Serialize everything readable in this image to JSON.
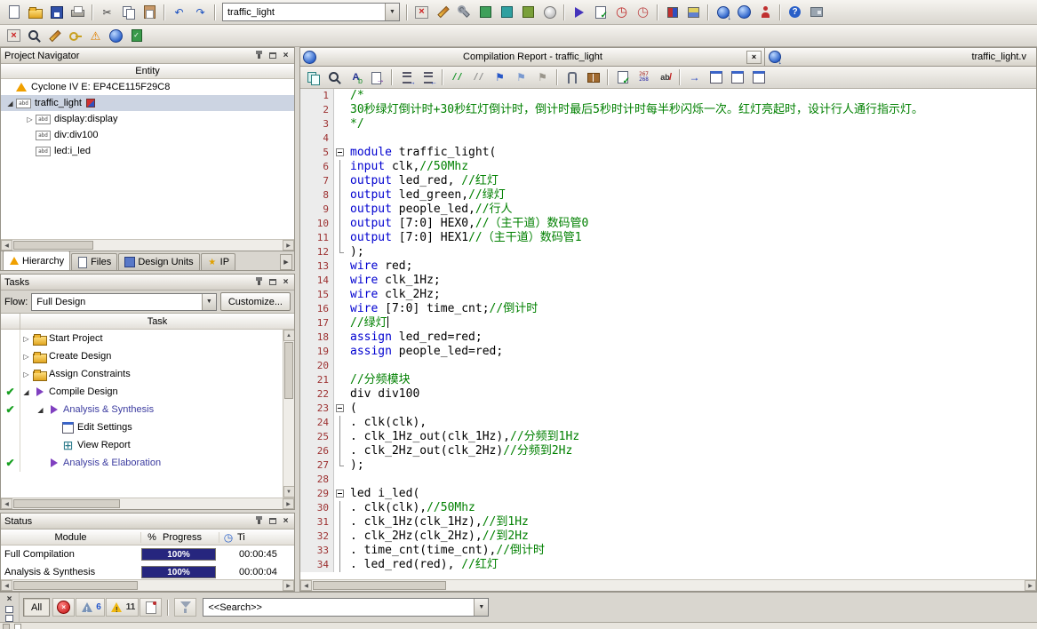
{
  "toolbar_main": {
    "combo_value": "traffic_light",
    "items_left": [
      {
        "n": "new-file",
        "s": "s-doc"
      },
      {
        "n": "open-file",
        "s": "s-folder"
      },
      {
        "n": "save",
        "s": "s-floppy"
      },
      {
        "n": "print",
        "s": "s-printer"
      },
      {
        "sep": 1
      },
      {
        "n": "cut",
        "g": "✂",
        "c": "#3a3a3a"
      },
      {
        "n": "copy",
        "s": "s-copy"
      },
      {
        "n": "paste",
        "s": "s-paste"
      },
      {
        "sep": 1
      },
      {
        "n": "undo",
        "g": "↶",
        "c": "#1a50c0"
      },
      {
        "n": "redo",
        "g": "↷",
        "c": "#1a50c0"
      },
      {
        "sep": 1
      }
    ],
    "items_right": [
      {
        "sep": 1
      },
      {
        "n": "stop-processing",
        "s": "s-redx"
      },
      {
        "n": "assignment-editor",
        "s": "s-pencil"
      },
      {
        "n": "pin-planner",
        "s": "s-wrench"
      },
      {
        "n": "rtl-viewer",
        "s": "s-chip"
      },
      {
        "n": "state-machine-viewer",
        "s": "s-chip2"
      },
      {
        "n": "technology-map-viewer",
        "s": "s-chip3"
      },
      {
        "n": "simulator",
        "s": "s-cd"
      },
      {
        "sep": 1
      },
      {
        "n": "start-compilation",
        "s": "s-play"
      },
      {
        "n": "start-analysis-synthesis",
        "s": "s-checkdoc"
      },
      {
        "n": "timequest-analyzer",
        "s": "s-clockred"
      },
      {
        "n": "timing-analyzer",
        "s": "s-clockred2"
      },
      {
        "sep": 1
      },
      {
        "n": "chip-planner",
        "s": "s-chipsm"
      },
      {
        "n": "design-partition",
        "s": "s-part"
      },
      {
        "sep": 1
      },
      {
        "n": "programmer",
        "s": "s-globedown"
      },
      {
        "n": "system-console",
        "s": "s-globe"
      },
      {
        "n": "qsys",
        "s": "s-person"
      },
      {
        "sep": 1
      },
      {
        "n": "help",
        "s": "s-help"
      },
      {
        "n": "system-builder",
        "s": "s-board"
      }
    ]
  },
  "toolbar_secondary": {
    "items": [
      {
        "n": "stop",
        "s": "s-redx"
      },
      {
        "n": "find",
        "s": "s-find"
      },
      {
        "n": "edit-pencil",
        "s": "s-pencil"
      },
      {
        "n": "key",
        "s": "s-key"
      },
      {
        "n": "alert",
        "s": "s-warno"
      },
      {
        "n": "web",
        "s": "s-globe"
      },
      {
        "n": "check-report",
        "s": "s-greendoc"
      }
    ]
  },
  "project_navigator": {
    "title": "Project Navigator",
    "entity_header": "Entity",
    "rows": [
      {
        "label": "Cyclone IV E: EP4CE115F29C8",
        "level": 0,
        "icon": "dev"
      },
      {
        "label": "traffic_light",
        "level": 0,
        "exp": "open",
        "icon": "abd",
        "badge": true,
        "selected": true
      },
      {
        "label": "display:display",
        "level": 1,
        "exp": "closed",
        "icon": "abd"
      },
      {
        "label": "div:div100",
        "level": 1,
        "icon": "abd"
      },
      {
        "label": "led:i_led",
        "level": 1,
        "icon": "abd"
      }
    ],
    "tabs": [
      {
        "label": "Hierarchy",
        "icon": "hier",
        "active": true
      },
      {
        "label": "Files",
        "icon": "files"
      },
      {
        "label": "Design Units",
        "icon": "du"
      },
      {
        "label": "IP",
        "icon": "ip"
      }
    ]
  },
  "tasks": {
    "title": "Tasks",
    "flow_label": "Flow:",
    "flow_value": "Full Design",
    "customize_label": "Customize...",
    "column_header": "Task",
    "rows": [
      {
        "label": "Start Project",
        "level": 1,
        "exp": "closed",
        "icon": "folder"
      },
      {
        "label": "Create Design",
        "level": 1,
        "exp": "closed",
        "icon": "folder"
      },
      {
        "label": "Assign Constraints",
        "level": 1,
        "exp": "closed",
        "icon": "folder"
      },
      {
        "label": "Compile Design",
        "level": 1,
        "exp": "open",
        "icon": "playp",
        "check": true
      },
      {
        "label": "Analysis & Synthesis",
        "level": 2,
        "exp": "open",
        "icon": "playp",
        "check": true,
        "emph": true
      },
      {
        "label": "Edit Settings",
        "level": 3,
        "icon": "winset"
      },
      {
        "label": "View Report",
        "level": 3,
        "icon": "grid"
      },
      {
        "label": "Analysis & Elaboration",
        "level": 2,
        "icon": "playp",
        "check": true,
        "emph": true
      }
    ]
  },
  "status": {
    "title": "Status",
    "columns": {
      "module": "Module",
      "percent": "%",
      "progress": "Progress",
      "time": "Ti"
    },
    "rows": [
      {
        "module": "Full Compilation",
        "progress": "100%",
        "time": "00:00:45"
      },
      {
        "module": "Analysis & Synthesis",
        "progress": "100%",
        "time": "00:00:04"
      }
    ]
  },
  "mdi": {
    "report_title": "Compilation Report - traffic_light",
    "editor_title": "traffic_light.v",
    "editor_toolbar": [
      {
        "n": "copy-document",
        "s": "s-copy2"
      },
      {
        "n": "find",
        "s": "s-find"
      },
      {
        "n": "find-replace",
        "s": "s-ab2"
      },
      {
        "n": "goto-line",
        "s": "s-goto"
      },
      {
        "sep": 1
      },
      {
        "n": "indent",
        "s": "s-ind"
      },
      {
        "n": "unindent",
        "s": "s-unind"
      },
      {
        "sep": 1
      },
      {
        "n": "comment",
        "s": "s-cmt"
      },
      {
        "n": "uncomment",
        "s": "s-uncmt"
      },
      {
        "n": "toggle-bookmark",
        "g": "⚑",
        "c": "#2858c8"
      },
      {
        "n": "next-bookmark",
        "g": "⚑",
        "c": "#7a9ad0"
      },
      {
        "n": "clear-bookmarks",
        "g": "⚑",
        "c": "#9a968c"
      },
      {
        "sep": 1
      },
      {
        "n": "insert-template",
        "s": "s-clip"
      },
      {
        "n": "templates-book",
        "s": "s-book"
      },
      {
        "sep": 1
      },
      {
        "n": "check-syntax",
        "s": "s-checkdoc"
      },
      {
        "n": "line-numbers",
        "s": "s-nums",
        "t1": "267",
        "t2": "268"
      },
      {
        "n": "word-wrap",
        "s": "s-abred"
      },
      {
        "sep": 1
      },
      {
        "n": "goto-matching",
        "g": "→",
        "c": "#2040c0"
      },
      {
        "n": "split-window-1",
        "s": "s-win"
      },
      {
        "n": "split-window-2",
        "s": "s-win"
      },
      {
        "n": "split-window-3",
        "s": "s-win"
      }
    ]
  },
  "editor": {
    "lines": [
      {
        "n": 1,
        "s": [
          [
            "c",
            "/*"
          ]
        ]
      },
      {
        "n": 2,
        "s": [
          [
            "c",
            "30秒绿灯倒计时+30秒红灯倒计时，倒计时最后5秒时计时每半秒闪烁一次。红灯亮起时，设计行人通行指示灯。"
          ]
        ]
      },
      {
        "n": 3,
        "s": [
          [
            "c",
            "*/"
          ]
        ]
      },
      {
        "n": 4,
        "s": []
      },
      {
        "n": 5,
        "f": "open",
        "s": [
          [
            "k",
            "module"
          ],
          [
            "p",
            " traffic_light("
          ]
        ]
      },
      {
        "n": 6,
        "f": "line",
        "s": [
          [
            "k",
            "input"
          ],
          [
            "p",
            " clk,"
          ],
          [
            "c",
            "//50Mhz"
          ]
        ]
      },
      {
        "n": 7,
        "f": "line",
        "s": [
          [
            "k",
            "output"
          ],
          [
            "p",
            " led_red, "
          ],
          [
            "c",
            "//红灯"
          ]
        ]
      },
      {
        "n": 8,
        "f": "line",
        "s": [
          [
            "k",
            "output"
          ],
          [
            "p",
            " led_green,"
          ],
          [
            "c",
            "//绿灯"
          ]
        ]
      },
      {
        "n": 9,
        "f": "line",
        "s": [
          [
            "k",
            "output"
          ],
          [
            "p",
            " people_led,"
          ],
          [
            "c",
            "//行人"
          ]
        ]
      },
      {
        "n": 10,
        "f": "line",
        "s": [
          [
            "k",
            "output"
          ],
          [
            "p",
            " [7:0] HEX0,"
          ],
          [
            "c",
            "//（主干道）数码管0"
          ]
        ]
      },
      {
        "n": 11,
        "f": "line",
        "s": [
          [
            "k",
            "output"
          ],
          [
            "p",
            " [7:0] HEX1"
          ],
          [
            "c",
            "//（主干道）数码管1"
          ]
        ]
      },
      {
        "n": 12,
        "f": "end",
        "s": [
          [
            "p",
            ");"
          ]
        ]
      },
      {
        "n": 13,
        "s": [
          [
            "k",
            "wire"
          ],
          [
            "p",
            " red;"
          ]
        ]
      },
      {
        "n": 14,
        "s": [
          [
            "k",
            "wire"
          ],
          [
            "p",
            " clk_1Hz;"
          ]
        ]
      },
      {
        "n": 15,
        "s": [
          [
            "k",
            "wire"
          ],
          [
            "p",
            " clk_2Hz;"
          ]
        ]
      },
      {
        "n": 16,
        "s": [
          [
            "k",
            "wire"
          ],
          [
            "p",
            " [7:0] time_cnt;"
          ],
          [
            "c",
            "//倒计时"
          ]
        ]
      },
      {
        "n": 17,
        "caret": true,
        "s": [
          [
            "c",
            "//绿灯"
          ]
        ]
      },
      {
        "n": 18,
        "s": [
          [
            "k",
            "assign"
          ],
          [
            "p",
            " led_red=red;"
          ]
        ]
      },
      {
        "n": 19,
        "s": [
          [
            "k",
            "assign"
          ],
          [
            "p",
            " people_led=red;"
          ]
        ]
      },
      {
        "n": 20,
        "s": []
      },
      {
        "n": 21,
        "s": [
          [
            "c",
            "//分频模块"
          ]
        ]
      },
      {
        "n": 22,
        "s": [
          [
            "p",
            "div div100"
          ]
        ]
      },
      {
        "n": 23,
        "f": "open",
        "s": [
          [
            "p",
            "("
          ]
        ]
      },
      {
        "n": 24,
        "f": "line",
        "s": [
          [
            "p",
            ". clk(clk),"
          ]
        ]
      },
      {
        "n": 25,
        "f": "line",
        "s": [
          [
            "p",
            ". clk_1Hz_out(clk_1Hz),"
          ],
          [
            "c",
            "//分频到1Hz"
          ]
        ]
      },
      {
        "n": 26,
        "f": "line",
        "s": [
          [
            "p",
            ". clk_2Hz_out(clk_2Hz)"
          ],
          [
            "c",
            "//分频到2Hz"
          ]
        ]
      },
      {
        "n": 27,
        "f": "end",
        "s": [
          [
            "p",
            ");"
          ]
        ]
      },
      {
        "n": 28,
        "s": []
      },
      {
        "n": 29,
        "f": "open",
        "s": [
          [
            "p",
            "led i_led("
          ]
        ]
      },
      {
        "n": 30,
        "f": "line",
        "s": [
          [
            "p",
            ". clk(clk),"
          ],
          [
            "c",
            "//50Mhz"
          ]
        ]
      },
      {
        "n": 31,
        "f": "line",
        "s": [
          [
            "p",
            ". clk_1Hz(clk_1Hz),"
          ],
          [
            "c",
            "//到1Hz"
          ]
        ]
      },
      {
        "n": 32,
        "f": "line",
        "s": [
          [
            "p",
            ". clk_2Hz(clk_2Hz),"
          ],
          [
            "c",
            "//到2Hz"
          ]
        ]
      },
      {
        "n": 33,
        "f": "line",
        "s": [
          [
            "p",
            ". time_cnt(time_cnt),"
          ],
          [
            "c",
            "//倒计时"
          ]
        ]
      },
      {
        "n": 34,
        "f": "line",
        "s": [
          [
            "p",
            ". led_red(red), "
          ],
          [
            "c",
            "//红灯"
          ]
        ]
      }
    ]
  },
  "messages": {
    "all_label": "All",
    "search_placeholder": "<<Search>>",
    "filters": [
      {
        "n": "error-filter",
        "s": "s-errball"
      },
      {
        "n": "warning-filter",
        "s": "s-warnb",
        "badge": "6",
        "bc": "#2255cc"
      },
      {
        "n": "critical-warning-filter",
        "s": "s-warny",
        "badge": "11",
        "bc": "#333333"
      },
      {
        "n": "info-filter",
        "s": "s-infodoc"
      }
    ]
  }
}
